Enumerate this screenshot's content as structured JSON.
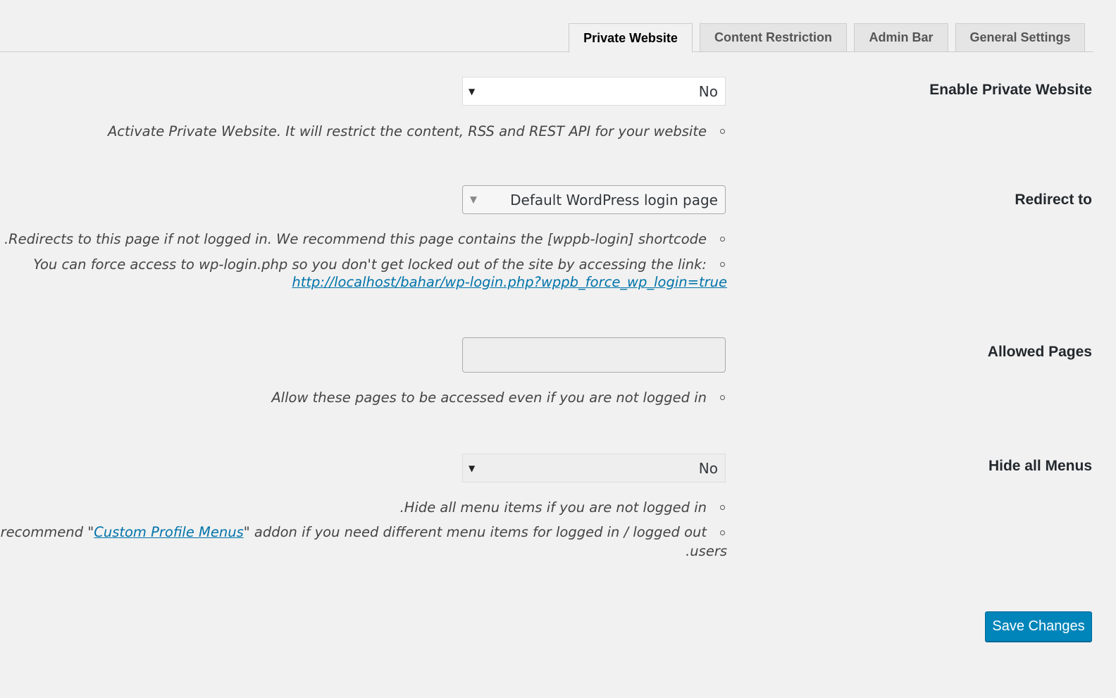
{
  "tabs": [
    {
      "label": "Private Website",
      "active": true
    },
    {
      "label": "Content Restriction",
      "active": false
    },
    {
      "label": "Admin Bar",
      "active": false
    },
    {
      "label": "General Settings",
      "active": false
    }
  ],
  "fields": {
    "enable_private": {
      "label": "Enable Private Website",
      "value": "No",
      "description": "Activate Private Website. It will restrict the content, RSS and REST API for your website"
    },
    "redirect_to": {
      "label": "Redirect to",
      "value": "Default WordPress login page",
      "description_1": ".Redirects to this page if not logged in. We recommend this page contains the [wppb-login] shortcode",
      "description_2": "You can force access to wp-login.php so you don't get locked out of the site by accessing the link:",
      "link": "http://localhost/bahar/wp-login.php?wppb_force_wp_login=true"
    },
    "allowed_pages": {
      "label": "Allowed Pages",
      "value": "",
      "description": "Allow these pages to be accessed even if you are not logged in"
    },
    "hide_menus": {
      "label": "Hide all Menus",
      "value": "No",
      "description_1": ".Hide all menu items if you are not logged in",
      "description_2_prefix": "We recommend \"",
      "description_2_link": "Custom Profile Menus",
      "description_2_suffix": "\" addon if you need different menu items for logged in / logged out",
      "description_2_tail": ".users"
    }
  },
  "actions": {
    "save_label": "Save Changes"
  },
  "colors": {
    "background": "#f1f1f1",
    "primary_button": "#0085ba",
    "link": "#0073aa"
  }
}
